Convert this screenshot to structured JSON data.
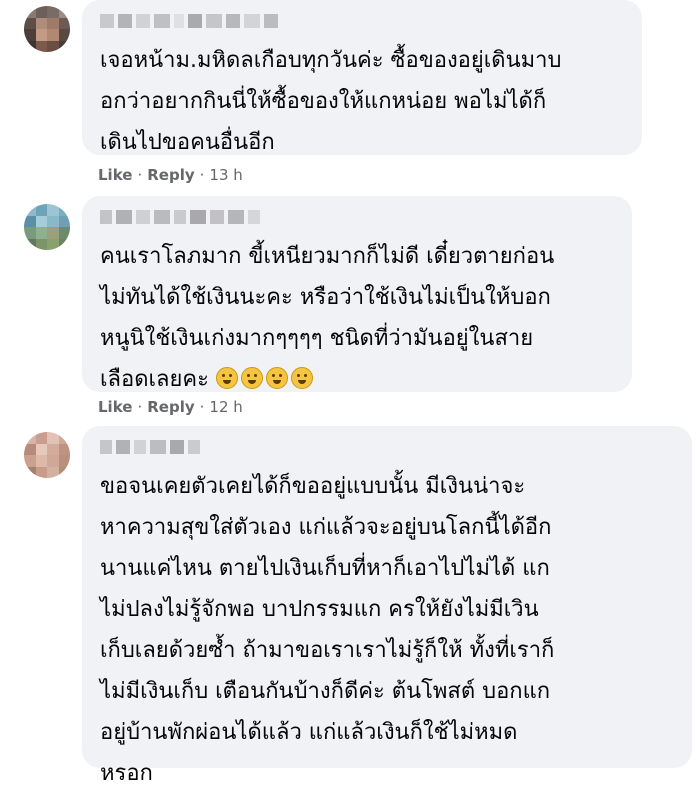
{
  "comments": [
    {
      "text": "เจอหน้าม.มหิดลเกือบทุกวันค่ะ ซื้อของอยู่เดินมาบ\nอกว่าอยากกินนี่ให้ซื้อของให้แกหน่อย พอไม่ได้ก็\nเดินไปขอคนอื่นอีก",
      "like_label": "Like",
      "reply_label": "Reply",
      "time": "13 h"
    },
    {
      "text": "คนเราโลภมาก ขี้เหนียวมากก็ไม่ดี เดี๋ยวตายก่อน\nไม่ทันได้ใช้เงินนะคะ หรือว่าใช้เงินไม่เป็นให้บอก\nหนูนิใช้เงินเก่งมากๆๆๆๆ ชนิดที่ว่ามันอยู่ในสาย\nเลือดเลยคะ",
      "like_label": "Like",
      "reply_label": "Reply",
      "time": "12 h"
    },
    {
      "text": "ขอจนเคยตัวเคยได้ก็ขออยู่แบบนั้น มีเงินน่าจะ\nหาความสุขใส่ตัวเอง แก่แล้วจะอยู่บนโลกนี้ได้อีก\nนานแค่ไหน ตายไปเงินเก็บที่หาก็เอาไปไม่ได้ แก\nไม่ปลงไม่รู้จักพอ บาปกรรมแก ครให้ยังไม่มีเวิน\nเก็บเลยด้วยซ้ำ ถ้ามาขอเราเราไม่รู้ก็ให้ ทั้งที่เราก็\nไม่มีเงินเก็บ เตือนกันบ้างก็ดีค่ะ ต้นโพสต์ บอกแก\nอยู่บ้านพักผ่อนได้แล้ว แก่แล้วเงินก็ใช้ไม่หมด\nหรอก"
    }
  ],
  "colors": {
    "bubble": "#f0f2f5",
    "text": "#050505",
    "meta": "#65676b"
  }
}
